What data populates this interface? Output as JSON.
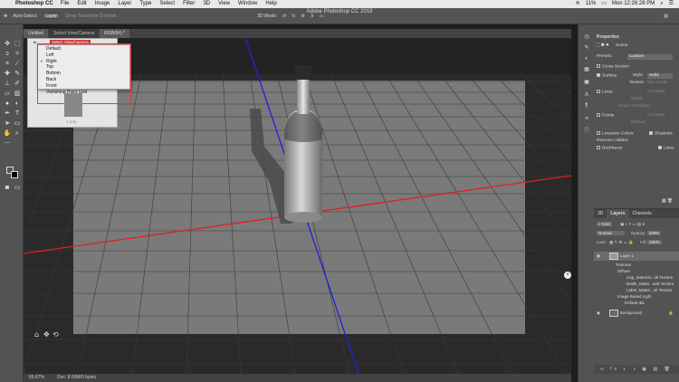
{
  "menubar": {
    "app_name": "Photoshop CC",
    "items": [
      "File",
      "Edit",
      "Image",
      "Layer",
      "Type",
      "Select",
      "Filter",
      "3D",
      "View",
      "Window",
      "Help"
    ],
    "battery": "11%",
    "clock": "Mon 12:26:28 PM"
  },
  "window_title": "Adobe Photoshop CC 2019",
  "options": {
    "auto_select_label": "Auto-Select:",
    "auto_select_value": "Layer",
    "transform_label": "Show Transform Controls",
    "mode_label": "3D Mode:"
  },
  "tabs": [
    {
      "label": "Untitled"
    },
    {
      "label": "Select View/Camera"
    },
    {
      "label": "RGB/8#) *"
    }
  ],
  "view_menu": {
    "header": "Select View/Camera",
    "items": [
      {
        "label": "Default",
        "checked": false
      },
      {
        "label": "Left",
        "checked": false
      },
      {
        "label": "Right",
        "checked": true
      },
      {
        "label": "Top",
        "checked": false
      },
      {
        "label": "Bottom",
        "checked": false
      },
      {
        "label": "Back",
        "checked": false
      },
      {
        "label": "Front",
        "checked": false
      },
      {
        "label": "Vanishing Point Grid",
        "checked": false
      }
    ],
    "check_mark": "✓",
    "preview_label": "Y  Z  %"
  },
  "status": {
    "zoom": "66.67%",
    "doc": "Doc: 8.69M/0 bytes"
  },
  "properties": {
    "title": "Properties",
    "scene_label": "Scene",
    "presets_label": "Presets:",
    "presets_value": "Custom",
    "cross_section": "Cross Section",
    "surface": "Surface",
    "style_label": "Style:",
    "style_value": "Solid",
    "texture_label": "Texture:",
    "texture_value": "Not Availa...",
    "lines": "Lines",
    "lines_style_value": "Constant",
    "width_label": "Width:",
    "angle_label": "Angle Threshold:",
    "points": "Points",
    "points_style_value": "Constant",
    "radius_label": "Radius:",
    "linearize": "Linearize Colors",
    "shadows": "Shadows",
    "remove_hidden": "Remove Hidden:",
    "backfaces": "Backfaces",
    "lines_chk": "Lines"
  },
  "layers_panel": {
    "tabs": [
      "3D",
      "Layers",
      "Channels"
    ],
    "kind": "Kind",
    "blend": "Normal",
    "opacity_label": "Opacity:",
    "opacity": "100%",
    "lock_label": "Lock:",
    "fill_label": "Fill:",
    "fill": "100%",
    "rows": [
      {
        "name": "Layer 1",
        "indent": 29,
        "eye": true,
        "selected": true
      },
      {
        "name": "Textures",
        "indent": 24,
        "eye": false
      },
      {
        "name": "Diffuse",
        "indent": 26,
        "eye": false
      },
      {
        "name": "Cap_Material...ult Texture",
        "indent": 36,
        "eye": false
      },
      {
        "name": "Bottle_Mater...ault Texture",
        "indent": 36,
        "eye": false
      },
      {
        "name": "Label_Materi...ult Texture",
        "indent": 36,
        "eye": false
      },
      {
        "name": "Image Based Light",
        "indent": 26,
        "eye": false
      },
      {
        "name": "Default IBL",
        "indent": 34,
        "eye": false
      },
      {
        "name": "Background",
        "indent": 29,
        "eye": true
      }
    ]
  },
  "colors": {
    "x_axis": "#e02020",
    "y_axis": "#2020e0"
  }
}
